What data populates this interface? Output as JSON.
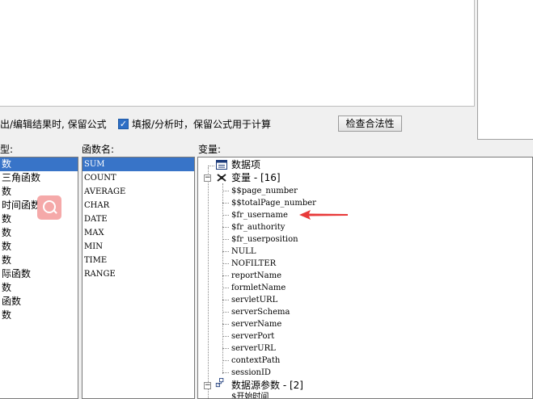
{
  "options": {
    "keep_formula_edit_label": "出/编辑结果时, 保留公式",
    "keep_formula_fill_label": "填报/分析时，保留公式用于计算",
    "keep_formula_fill_checked": true,
    "check_validity_button": "检查合法性"
  },
  "labels": {
    "category": "型:",
    "function_name": "函数名:",
    "variables": "变量:"
  },
  "categories": [
    "数",
    "三角函数",
    "数",
    "时间函数",
    "数",
    "数",
    "数",
    "数",
    "际函数",
    "数",
    "函数",
    "数"
  ],
  "functions": [
    "SUM",
    "COUNT",
    "AVERAGE",
    "CHAR",
    "DATE",
    "MAX",
    "MIN",
    "TIME",
    "RANGE"
  ],
  "tree": {
    "data_item_label": "数据项",
    "variables_label": "变量 - [16]",
    "variables": [
      "$$page_number",
      "$$totalPage_number",
      "$fr_username",
      "$fr_authority",
      "$fr_userposition",
      "NULL",
      "NOFILTER",
      "reportName",
      "formletName",
      "servletURL",
      "serverSchema",
      "serverName",
      "serverPort",
      "serverURL",
      "contextPath",
      "sessionID"
    ],
    "ds_params_label": "数据源参数 - [2]",
    "ds_params": [
      "$开始时间"
    ]
  },
  "colors": {
    "selection": "#3874c8",
    "annotation_arrow": "#e83a3a"
  }
}
